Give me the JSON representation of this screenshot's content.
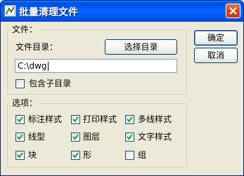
{
  "window": {
    "title": "批量清理文件"
  },
  "files_group": {
    "title": "文件：",
    "dir_label": "文件目录：",
    "select_dir_button": "选择目录",
    "dir_value": "C:\\dwg",
    "include_subdirs_label": "包含子目录",
    "include_subdirs_checked": false
  },
  "options_group": {
    "title": "选项：",
    "items": [
      {
        "label": "标注样式",
        "checked": true
      },
      {
        "label": "打印样式",
        "checked": true
      },
      {
        "label": "多线样式",
        "checked": true
      },
      {
        "label": "线型",
        "checked": true
      },
      {
        "label": "图层",
        "checked": true
      },
      {
        "label": "文字样式",
        "checked": true
      },
      {
        "label": "块",
        "checked": true
      },
      {
        "label": "形",
        "checked": true
      },
      {
        "label": "组",
        "checked": false
      }
    ]
  },
  "buttons": {
    "ok": "确定",
    "cancel": "取消"
  },
  "colors": {
    "titlebar": "#0055ea",
    "dialog_bg": "#ece9d8",
    "close_button": "#d04a22",
    "check_mark": "#21a121"
  },
  "icons": {
    "app": "cad-app-icon",
    "close": "close-icon",
    "check": "check-mark-icon"
  }
}
